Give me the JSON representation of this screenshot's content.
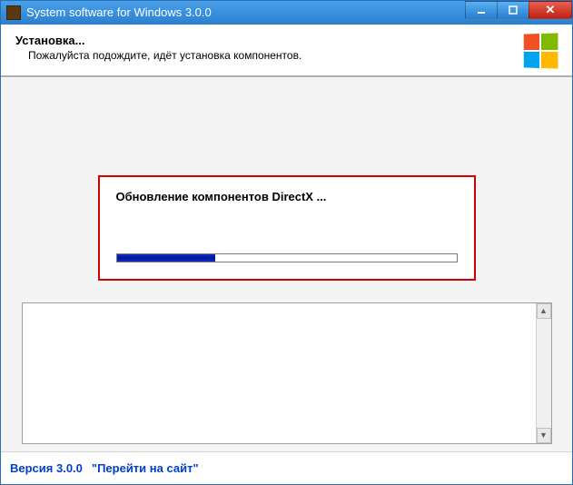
{
  "titlebar": {
    "title": "System software for Windows 3.0.0"
  },
  "header": {
    "heading": "Установка...",
    "subtext": "Пожалуйста подождите, идёт установка компонентов."
  },
  "progress": {
    "label": "Обновление компонентов DirectX ...",
    "percent": 29
  },
  "footer": {
    "version": "Версия 3.0.0",
    "link": "\"Перейти на сайт\""
  }
}
